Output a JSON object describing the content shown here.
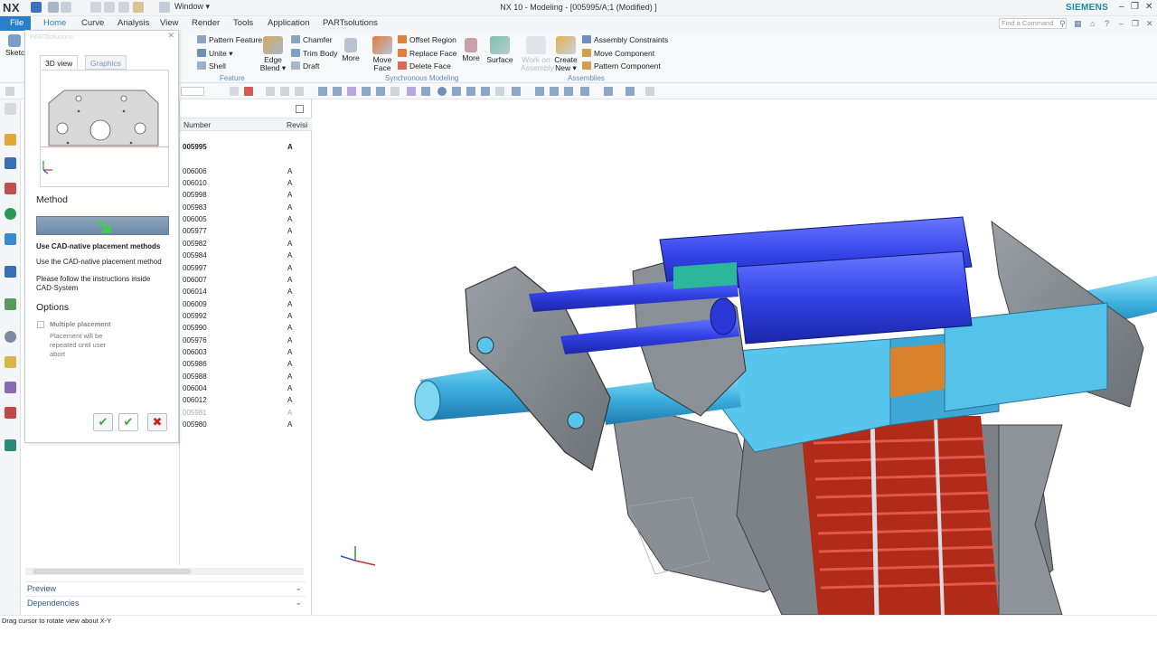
{
  "app": {
    "logo": "NX",
    "title": "NX 10 - Modeling - [005995/A;1 (Modified) ]",
    "brand": "SIEMENS",
    "window_menu": "Window ▾"
  },
  "menu_tabs": {
    "file": "File",
    "items": [
      "Home",
      "Curve",
      "Analysis",
      "View",
      "Render",
      "Tools",
      "Application",
      "PARTsolutions"
    ],
    "find_placeholder": "Find a Command"
  },
  "ribbon": {
    "feature": {
      "pattern_feature": "Pattern Feature",
      "unite": "Unite",
      "shell": "Shell",
      "chamfer": "Chamfer",
      "trim_body": "Trim Body",
      "draft": "Draft",
      "edge_blend": "Edge\nBlend",
      "more": "More",
      "group_label": "Feature"
    },
    "sync": {
      "offset_region": "Offset Region",
      "replace_face": "Replace Face",
      "delete_face": "Delete Face",
      "move_face": "Move\nFace",
      "more": "More",
      "group_label": "Synchronous Modeling"
    },
    "surface": "Surface",
    "assemblies": {
      "work_on_assembly": "Work on\nAssembly",
      "create_new": "Create\nNew",
      "assembly_constraints": "Assembly Constraints",
      "move_component": "Move Component",
      "pattern_component": "Pattern Component",
      "group_label": "Assemblies"
    }
  },
  "navigator": {
    "col_number": "Number",
    "col_revision": "Revisi",
    "root": {
      "number": "005995",
      "rev": "A"
    },
    "rows": [
      {
        "number": "006006",
        "rev": "A"
      },
      {
        "number": "006010",
        "rev": "A"
      },
      {
        "number": "005998",
        "rev": "A"
      },
      {
        "number": "005983",
        "rev": "A"
      },
      {
        "number": "006005",
        "rev": "A"
      },
      {
        "number": "005977",
        "rev": "A"
      },
      {
        "number": "005982",
        "rev": "A"
      },
      {
        "number": "005984",
        "rev": "A"
      },
      {
        "number": "005997",
        "rev": "A"
      },
      {
        "number": "006007",
        "rev": "A"
      },
      {
        "number": "006014",
        "rev": "A"
      },
      {
        "number": "006009",
        "rev": "A"
      },
      {
        "number": "005992",
        "rev": "A"
      },
      {
        "number": "005990",
        "rev": "A"
      },
      {
        "number": "005976",
        "rev": "A"
      },
      {
        "number": "006003",
        "rev": "A"
      },
      {
        "number": "005986",
        "rev": "A"
      },
      {
        "number": "005988",
        "rev": "A"
      },
      {
        "number": "006004",
        "rev": "A"
      },
      {
        "number": "006012",
        "rev": "A"
      },
      {
        "number": "005981",
        "rev": "A",
        "dim": true
      },
      {
        "number": "005980",
        "rev": "A"
      }
    ],
    "preview": "Preview",
    "dependencies": "Dependencies"
  },
  "dialog": {
    "title": "PARTsolutions",
    "tab_3d": "3D view",
    "tab_graphics": "Graphics",
    "method_heading": "Method",
    "cad_native_bold": "Use CAD-native placement methods",
    "cad_native": "Use the CAD-native placement method",
    "instructions": "Please follow the instructions inside CAD-System",
    "options_heading": "Options",
    "multiple_placement": "Multiple placement",
    "multiple_note": "Placement will be repeated until user abort"
  },
  "status": {
    "message": "Drag cursor to rotate view about X-Y"
  },
  "colors": {
    "accent": "#2b7fc9",
    "model_blue": "#3a46e0",
    "model_cyan": "#52c4e8",
    "model_grey": "#8e9398",
    "model_red": "#c8321e",
    "model_orange": "#d9822b",
    "model_green": "#2ab79a"
  }
}
